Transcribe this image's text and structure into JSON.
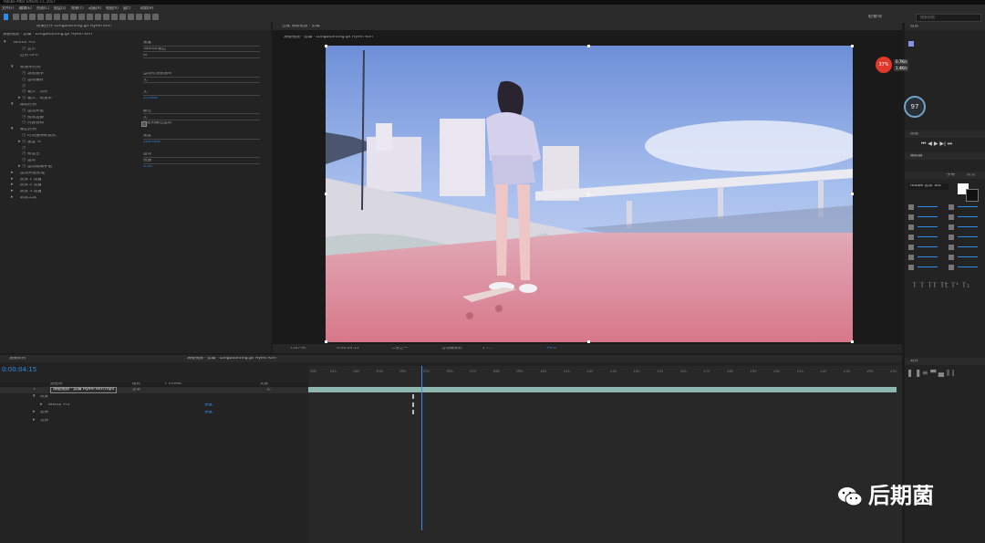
{
  "app": {
    "title": "Adobe After Effects CC 2017",
    "menu": [
      "文件(F)",
      "编辑(E)",
      "合成(C)",
      "图层(L)",
      "效果(T)",
      "动画(A)",
      "视图(V)",
      "窗口",
      "帮助(H)"
    ],
    "search_placeholder": "搜索帮助",
    "workspace": "必要项"
  },
  "effects_panel": {
    "tab": "效果控件 Longboarding.gif Hyein Kim",
    "path": "滑板视频 · 剪辑 · Longboarding.gif Hyein Kim",
    "rows": [
      {
        "label": "Twixtor Pro",
        "value": "重置",
        "indent": 0,
        "arrow": "▾"
      },
      {
        "label": "显示",
        "value": "Twixtor输出",
        "indent": 2
      },
      {
        "label": "启用 GPU",
        "value": "开",
        "indent": 1
      },
      {
        "label": "",
        "value": "",
        "indent": 1
      },
      {
        "label": "帧速率控制",
        "value": "",
        "indent": 1,
        "arrow": "▾"
      },
      {
        "label": "源帧速率",
        "value": "自动检测帧速率",
        "indent": 2
      },
      {
        "label": "运动偏好",
        "value": "无",
        "indent": 2
      },
      {
        "label": "",
        "value": "",
        "indent": 2
      },
      {
        "label": "输入：场序",
        "value": "无",
        "indent": 2
      },
      {
        "label": "输入：帧速率",
        "value": "25.000",
        "indent": 2,
        "arrow": "▸",
        "blue": true
      },
      {
        "label": "跟踪控制",
        "value": "",
        "indent": 1,
        "arrow": "▾"
      },
      {
        "label": "运动矢量",
        "value": "最佳",
        "indent": 2
      },
      {
        "label": "图像准备",
        "value": "无",
        "indent": 2
      },
      {
        "label": "内容感知",
        "value": "使用最佳运动",
        "indent": 2,
        "check": true
      },
      {
        "label": "输出控制",
        "value": "",
        "indent": 1,
        "arrow": "▾"
      },
      {
        "label": "时间重映射模式",
        "value": "速度",
        "indent": 2
      },
      {
        "label": "速度 %",
        "value": "100.000",
        "indent": 2,
        "arrow": "▸",
        "blue": true
      },
      {
        "label": "",
        "value": "",
        "indent": 2
      },
      {
        "label": "帧混合",
        "value": "运动",
        "indent": 2
      },
      {
        "label": "运动",
        "value": "扭曲",
        "indent": 2
      },
      {
        "label": "运动模糊补偿",
        "value": "0.00",
        "indent": 2,
        "arrow": "▸",
        "blue": true
      },
      {
        "label": "运动矢量处理",
        "value": "",
        "indent": 1,
        "arrow": "▸"
      },
      {
        "label": "前景 1 设置",
        "value": "",
        "indent": 1,
        "arrow": "▸"
      },
      {
        "label": "前景 2 设置",
        "value": "",
        "indent": 1,
        "arrow": "▸"
      },
      {
        "label": "前景 3 设置",
        "value": "",
        "indent": 1,
        "arrow": "▸"
      },
      {
        "label": "调试工具",
        "value": "",
        "indent": 1,
        "arrow": "▸"
      }
    ]
  },
  "viewer": {
    "tab": "合成 滑板视频 · 剪辑",
    "breadcrumb": "滑板视频 · 剪辑 · Longboarding.gif Hyein Kim",
    "zoom": "(107%)",
    "timecode": "0:00:04:15",
    "resolution": "二分之一",
    "camera": "活动摄像机",
    "views": "1个...",
    "exposure": "+0.0"
  },
  "timeline": {
    "tab_render": "渲染队列",
    "tab_comp": "滑板视频 · 剪辑 · Longboarding.gif Hyein Kim",
    "current_time": "0:00:04:15",
    "columns": [
      "源名称",
      "模式",
      "T TrkMat",
      "父级"
    ],
    "layer": {
      "index": "1",
      "name": "滑板视频 · 剪辑 Hyein Kim.mp4",
      "mode": "正常",
      "parent": "无"
    },
    "sublayers": [
      {
        "label": "效果",
        "value": "",
        "indent": 0
      },
      {
        "label": "Twixtor Pro",
        "value": "重置",
        "indent": 1
      },
      {
        "label": "变换",
        "value": "重置",
        "indent": 0
      },
      {
        "label": "音频",
        "value": "",
        "indent": 0
      }
    ],
    "ruler": [
      "00s",
      "01s",
      "02s",
      "03s",
      "04s",
      "05s",
      "06s",
      "07s",
      "08s",
      "09s",
      "10s",
      "11s",
      "12s",
      "13s",
      "14s",
      "15s",
      "16s",
      "17s",
      "18s",
      "19s",
      "20s",
      "21s",
      "22s",
      "23s",
      "24s",
      "25s"
    ],
    "playhead_fraction": 0.19
  },
  "right_panel": {
    "info_tab": "信息",
    "cpu_percent": "37%",
    "net_up": "0.7K/s",
    "net_down": "1.4K/s",
    "gauge": "97",
    "preview_tab": "预览",
    "tracker_tab": "跟踪器",
    "char_tab": "字符",
    "paragraph_tab": "段落",
    "font": "Adobe 黑体 Std",
    "align_tab": "对齐"
  },
  "watermark": {
    "text": "后期菌"
  },
  "colors": {
    "accent": "#2d8ceb",
    "panel": "#232323",
    "layer_bar": "#8eb7b0",
    "gauge": "#e0392b"
  }
}
